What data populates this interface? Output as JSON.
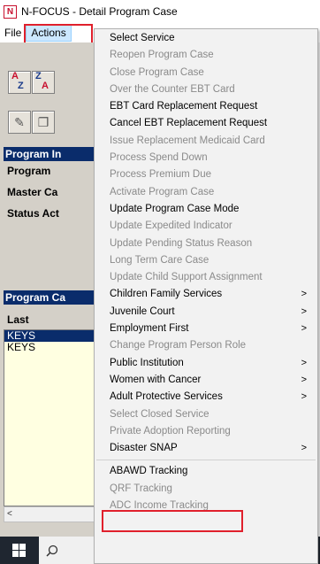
{
  "window": {
    "title": "N-FOCUS - Detail Program Case",
    "icon_letter": "N"
  },
  "menubar": {
    "items": [
      {
        "label": "File"
      },
      {
        "label": "Actions"
      }
    ]
  },
  "left_panel": {
    "sort_buttons": [
      {
        "top": "A",
        "bottom": "Z"
      },
      {
        "top": "Z",
        "bottom": "A"
      }
    ],
    "section1_header": "Program In",
    "labels": [
      "Program",
      "Master Ca",
      "Status  Act"
    ],
    "section2_header": "Program Ca",
    "column_header": "Last",
    "rows": [
      "KEYS",
      "KEYS"
    ],
    "scroll_left": "<"
  },
  "actions_menu": {
    "items": [
      {
        "label": "Select Service",
        "enabled": true,
        "submenu": false
      },
      {
        "label": "Reopen Program Case",
        "enabled": false,
        "submenu": false
      },
      {
        "label": "Close Program Case",
        "enabled": false,
        "submenu": false
      },
      {
        "label": "Over the Counter EBT Card",
        "enabled": false,
        "submenu": false
      },
      {
        "label": "EBT Card Replacement Request",
        "enabled": true,
        "submenu": false
      },
      {
        "label": "Cancel EBT Replacement Request",
        "enabled": true,
        "submenu": false
      },
      {
        "label": "Issue Replacement Medicaid Card",
        "enabled": false,
        "submenu": false
      },
      {
        "label": "Process Spend Down",
        "enabled": false,
        "submenu": false
      },
      {
        "label": "Process Premium Due",
        "enabled": false,
        "submenu": false
      },
      {
        "label": "Activate Program Case",
        "enabled": false,
        "submenu": false
      },
      {
        "label": "Update Program Case Mode",
        "enabled": true,
        "submenu": false
      },
      {
        "label": "Update Expedited Indicator",
        "enabled": false,
        "submenu": false
      },
      {
        "label": "Update Pending Status Reason",
        "enabled": false,
        "submenu": false
      },
      {
        "label": "Long Term Care Case",
        "enabled": false,
        "submenu": false
      },
      {
        "label": "Update Child Support Assignment",
        "enabled": false,
        "submenu": false
      },
      {
        "label": "Children Family Services",
        "enabled": true,
        "submenu": true
      },
      {
        "label": "Juvenile Court",
        "enabled": true,
        "submenu": true
      },
      {
        "label": "Employment First",
        "enabled": true,
        "submenu": true
      },
      {
        "label": "Change Program Person Role",
        "enabled": false,
        "submenu": false
      },
      {
        "label": "Public Institution",
        "enabled": true,
        "submenu": true
      },
      {
        "label": "Women with Cancer",
        "enabled": true,
        "submenu": true
      },
      {
        "label": "Adult Protective Services",
        "enabled": true,
        "submenu": true
      },
      {
        "label": "Select Closed Service",
        "enabled": false,
        "submenu": false
      },
      {
        "label": "Private Adoption Reporting",
        "enabled": false,
        "submenu": false
      },
      {
        "label": "Disaster SNAP",
        "enabled": true,
        "submenu": true
      }
    ],
    "after_separator": [
      {
        "label": "ABAWD Tracking",
        "enabled": true,
        "submenu": false
      },
      {
        "label": "QRF Tracking",
        "enabled": false,
        "submenu": false
      },
      {
        "label": "ADC Income Tracking",
        "enabled": false,
        "submenu": false
      }
    ],
    "submenu_arrow": ">"
  },
  "taskbar": {
    "search_icon": "search-icon",
    "start_icon": "windows-logo-icon"
  },
  "colors": {
    "highlight_box": "#e0202c",
    "menu_active_bg": "#cce8ff",
    "panel_header": "#0a2c6b"
  }
}
